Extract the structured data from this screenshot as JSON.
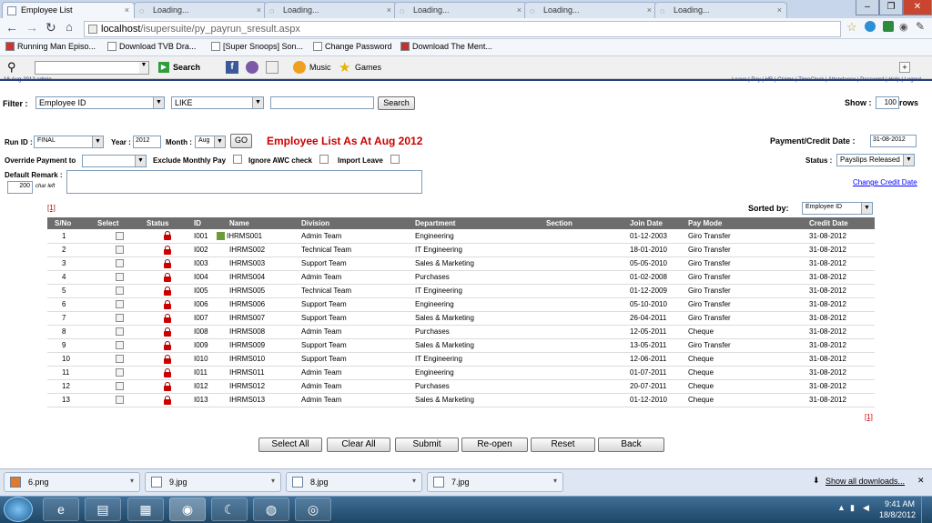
{
  "browser": {
    "tabs": [
      {
        "label": "Employee List",
        "active": true
      },
      {
        "label": "Loading...",
        "active": false
      },
      {
        "label": "Loading...",
        "active": false
      },
      {
        "label": "Loading...",
        "active": false
      },
      {
        "label": "Loading...",
        "active": false
      },
      {
        "label": "Loading...",
        "active": false
      }
    ],
    "url_host": "localhost",
    "url_path": "/isupersuite/py_payrun_sresult.aspx",
    "bookmarks": [
      "Running Man Episo...",
      "Download TVB Dra...",
      "[Super Snoops] Son...",
      "Change Password",
      "Download The Ment..."
    ],
    "toolbar": {
      "search_label": "Search",
      "music_label": "Music",
      "games_label": "Games"
    }
  },
  "page": {
    "header_left": "18-Aug-2012  admin",
    "header_links": "Leave | Pay | HR | Claims | TimeClock | Attendance | Password | Help | Logout",
    "filter": {
      "label": "Filter :",
      "field": "Employee ID",
      "operator": "LIKE",
      "value": "",
      "search_button": "Search",
      "show_label": "Show :",
      "show_value": "100",
      "rows_label": "rows"
    },
    "run": {
      "run_id_label": "Run ID :",
      "run_id": "FINAL",
      "year_label": "Year :",
      "year": "2012",
      "month_label": "Month :",
      "month": "Aug",
      "go_button": "GO",
      "title": "Employee List As At Aug 2012",
      "credit_date_label": "Payment/Credit Date :",
      "credit_date": "31-08-2012",
      "override_label": "Override Payment to",
      "override_value": "",
      "exclude_label": "Exclude Monthly Pay",
      "ignore_label": "Ignore AWC check",
      "import_label": "Import Leave",
      "status_label": "Status :",
      "status_value": "Payslips Released",
      "change_credit_link": "Change Credit Date",
      "default_remark_label": "Default Remark :",
      "char_count": "200",
      "char_left_label": "char left",
      "remark_value": ""
    },
    "page_link": "[1]",
    "sorted_by_label": "Sorted by:",
    "sorted_by_value": "Employee ID",
    "table": {
      "headers": [
        "S/No",
        "Select",
        "Status",
        "ID",
        "Name",
        "Division",
        "Department",
        "Section",
        "Join Date",
        "Pay Mode",
        "Credit Date"
      ],
      "rows": [
        [
          "1",
          "I001",
          "IHRMS001",
          "Admin Team",
          "Engineering",
          "",
          "01-12-2003",
          "Giro Transfer",
          "31-08-2012"
        ],
        [
          "2",
          "I002",
          "IHRMS002",
          "Technical Team",
          "IT Engineering",
          "",
          "18-01-2010",
          "Giro Transfer",
          "31-08-2012"
        ],
        [
          "3",
          "I003",
          "IHRMS003",
          "Support Team",
          "Sales & Marketing",
          "",
          "05-05-2010",
          "Giro Transfer",
          "31-08-2012"
        ],
        [
          "4",
          "I004",
          "IHRMS004",
          "Admin Team",
          "Purchases",
          "",
          "01-02-2008",
          "Giro Transfer",
          "31-08-2012"
        ],
        [
          "5",
          "I005",
          "IHRMS005",
          "Technical Team",
          "IT Engineering",
          "",
          "01-12-2009",
          "Giro Transfer",
          "31-08-2012"
        ],
        [
          "6",
          "I006",
          "IHRMS006",
          "Support Team",
          "Engineering",
          "",
          "05-10-2010",
          "Giro Transfer",
          "31-08-2012"
        ],
        [
          "7",
          "I007",
          "IHRMS007",
          "Support Team",
          "Sales & Marketing",
          "",
          "26-04-2011",
          "Giro Transfer",
          "31-08-2012"
        ],
        [
          "8",
          "I008",
          "IHRMS008",
          "Admin Team",
          "Purchases",
          "",
          "12-05-2011",
          "Cheque",
          "31-08-2012"
        ],
        [
          "9",
          "I009",
          "IHRMS009",
          "Support Team",
          "Sales & Marketing",
          "",
          "13-05-2011",
          "Giro Transfer",
          "31-08-2012"
        ],
        [
          "10",
          "I010",
          "IHRMS010",
          "Support Team",
          "IT Engineering",
          "",
          "12-06-2011",
          "Cheque",
          "31-08-2012"
        ],
        [
          "11",
          "I011",
          "IHRMS011",
          "Admin Team",
          "Engineering",
          "",
          "01-07-2011",
          "Cheque",
          "31-08-2012"
        ],
        [
          "12",
          "I012",
          "IHRMS012",
          "Admin Team",
          "Purchases",
          "",
          "20-07-2011",
          "Cheque",
          "31-08-2012"
        ],
        [
          "13",
          "I013",
          "IHRMS013",
          "Admin Team",
          "Sales & Marketing",
          "",
          "01-12-2010",
          "Cheque",
          "31-08-2012"
        ]
      ]
    },
    "buttons": [
      "Select All",
      "Clear All",
      "Submit",
      "Re-open",
      "Reset",
      "Back"
    ]
  },
  "downloads": {
    "items": [
      "6.png",
      "9.jpg",
      "8.jpg",
      "7.jpg"
    ],
    "show_all": "Show all downloads..."
  },
  "taskbar": {
    "time": "9:41 AM",
    "date": "18/8/2012"
  },
  "colors": {
    "title_red": "#cc0000",
    "header_gray": "#6d6d6d",
    "link_blue": "#0000ff"
  }
}
